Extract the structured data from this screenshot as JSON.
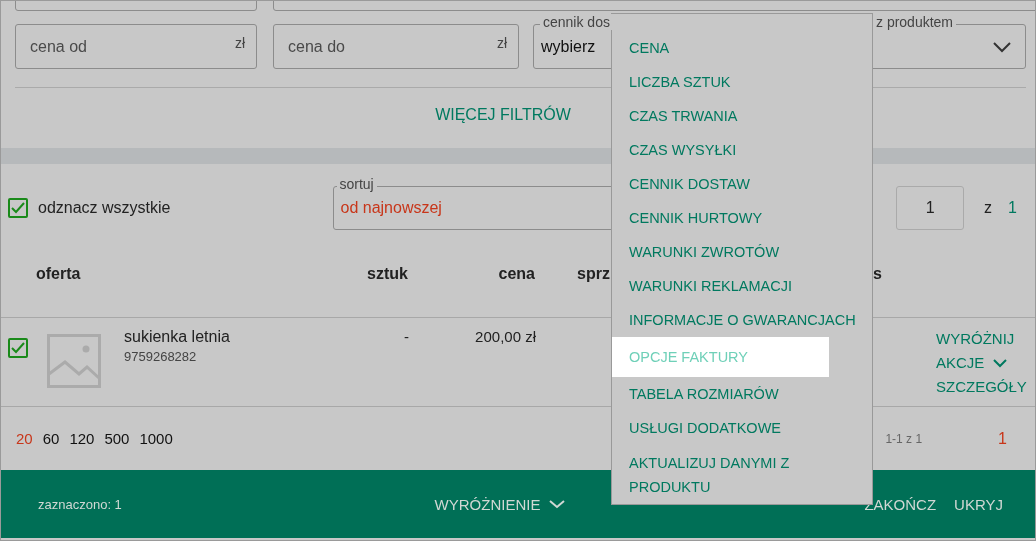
{
  "filters": [
    {
      "kind": "input",
      "placeholder": "cena od",
      "unit": "zł"
    },
    {
      "kind": "input",
      "placeholder": "cena do",
      "unit": "zł"
    },
    {
      "kind": "select",
      "label": "cennik dos",
      "value": "wybierz"
    },
    {
      "kind": "select",
      "label": "z produktem"
    }
  ],
  "more_filters": "WIĘCEJ FILTRÓW",
  "select_all": {
    "label": "odznacz wszystkie",
    "checked": true
  },
  "sort": {
    "label": "sortuj",
    "value": "od najnowszej"
  },
  "page": {
    "value": "1",
    "of_label": "z",
    "total": "1"
  },
  "columns": [
    {
      "label": "oferta"
    },
    {
      "label": "sztuk"
    },
    {
      "label": "cena"
    },
    {
      "label": "sprz"
    },
    {
      "label": "s"
    }
  ],
  "rows": [
    {
      "checked": true,
      "name": "sukienka letnia",
      "code": "9759268282",
      "quantity": "-",
      "price": "200,00 zł",
      "actions": [
        {
          "label": "WYRÓŻNIJ",
          "kind": "plain"
        },
        {
          "label": "AKCJE",
          "kind": "down"
        },
        {
          "label": "SZCZEGÓŁY",
          "kind": "plain"
        }
      ]
    }
  ],
  "page_sizes": [
    {
      "label": "20",
      "selected": true
    },
    {
      "label": "60",
      "selected": false
    },
    {
      "label": "120",
      "selected": false
    },
    {
      "label": "500",
      "selected": false
    },
    {
      "label": "1000",
      "selected": false
    }
  ],
  "range": "1-1 z 1",
  "pages": [
    {
      "label": "1",
      "selected": true
    }
  ],
  "bottom_bar": {
    "selected_count": "zaznaczono: 1",
    "actions": [
      {
        "label": "WYRÓŻNIENIE",
        "kind": "down"
      },
      {
        "label": "ZAKOŃCZ",
        "kind": "plain"
      },
      {
        "label": "UKRYJ",
        "kind": "plain"
      }
    ]
  },
  "menu": {
    "items": [
      {
        "label": "CENA",
        "selected": false
      },
      {
        "label": "LICZBA SZTUK",
        "selected": false
      },
      {
        "label": "CZAS TRWANIA",
        "selected": false
      },
      {
        "label": "CZAS WYSYŁKI",
        "selected": false
      },
      {
        "label": "CENNIK DOSTAW",
        "selected": false
      },
      {
        "label": "CENNIK HURTOWY",
        "selected": false
      },
      {
        "label": "WARUNKI ZWROTÓW",
        "selected": false
      },
      {
        "label": "WARUNKI REKLAMACJI",
        "selected": false
      },
      {
        "label": "INFORMACJE O GWARANCJACH",
        "selected": false
      },
      {
        "label": "OPCJE FAKTURY",
        "selected": true
      },
      {
        "label": "TABELA ROZMIARÓW",
        "selected": false
      },
      {
        "label": "USŁUGI DODATKOWE",
        "selected": false
      },
      {
        "label": "AKTUALIZUJ DANYMI Z PRODUKTU",
        "selected": false
      }
    ]
  }
}
